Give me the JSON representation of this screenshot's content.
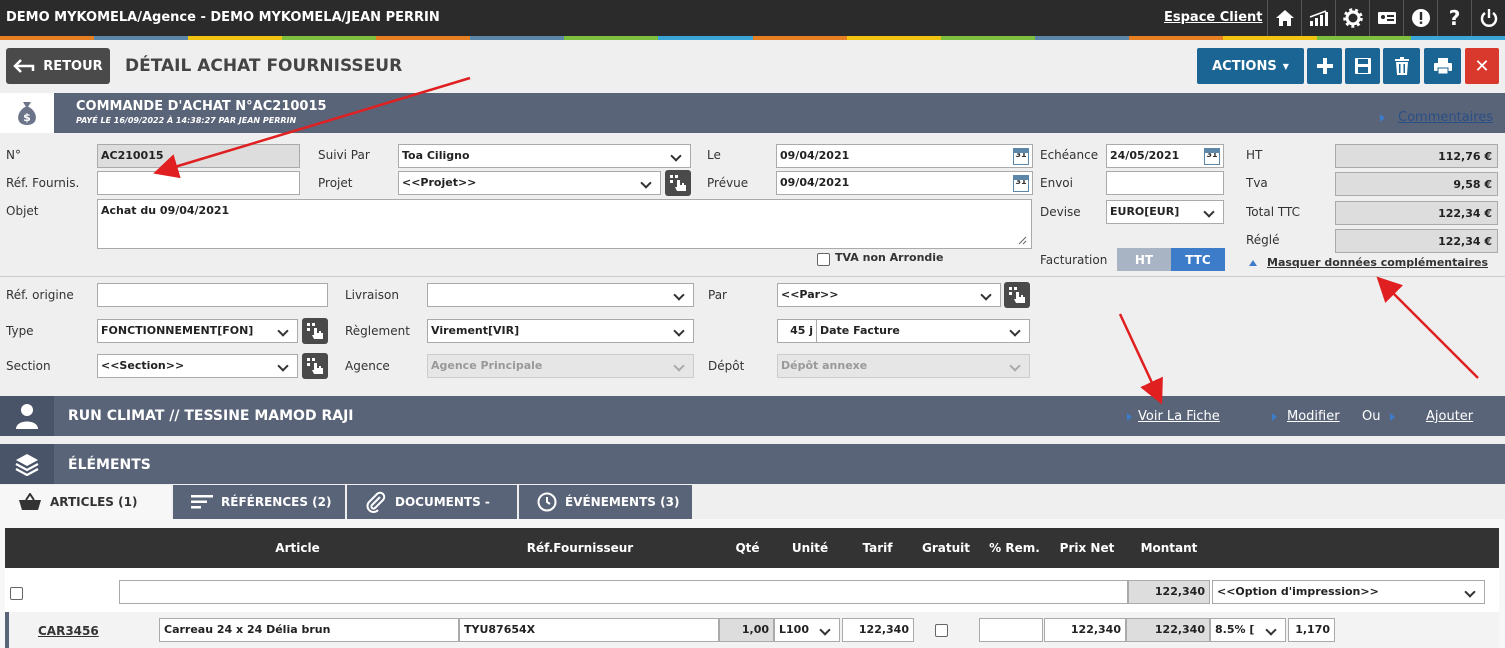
{
  "topbar": {
    "title": "DEMO MYKOMELA/Agence - DEMO MYKOMELA/JEAN PERRIN",
    "espace_client": "Espace Client",
    "icons": [
      "home-icon",
      "chart-icon",
      "gear-icon",
      "card-icon",
      "alert-icon",
      "help-icon",
      "power-icon"
    ]
  },
  "stripe_colors": [
    "#e67e22",
    "#5d87a8",
    "#f1c40f",
    "#7fbf3f",
    "#e67e22",
    "#5d87a8",
    "#7fbf3f",
    "#3aa6d8",
    "#e67e22",
    "#f1c40f",
    "#7fbf3f",
    "#5d87a8",
    "#e67e22",
    "#f1c40f",
    "#7fbf3f",
    "#3aa6d8"
  ],
  "header": {
    "back_label": "RETOUR",
    "page_title": "DÉTAIL ACHAT FOURNISSEUR",
    "actions_label": "ACTIONS"
  },
  "commande": {
    "title": "COMMANDE D'ACHAT N°AC210015",
    "subtitle": "PAYÉ LE 16/09/2022 À 14:38:27 PAR JEAN PERRIN",
    "commentaires": "Commentaires"
  },
  "form": {
    "no_label": "N°",
    "no_value": "AC210015",
    "ref_fournis_label": "Réf. Fournis.",
    "ref_fournis_value": "",
    "objet_label": "Objet",
    "objet_value": "Achat du 09/04/2021",
    "suivi_label": "Suivi Par",
    "suivi_value": "Toa Ciligno",
    "projet_label": "Projet",
    "projet_value": "<<Projet>>",
    "le_label": "Le",
    "le_value": "09/04/2021",
    "prevue_label": "Prévue",
    "prevue_value": "09/04/2021",
    "echeance_label": "Echéance",
    "echeance_value": "24/05/2021",
    "envoi_label": "Envoi",
    "envoi_value": "",
    "devise_label": "Devise",
    "devise_value": "EURO[EUR]",
    "tva_arrondie_label": "TVA non Arrondie",
    "facturation_label": "Facturation",
    "fact_ht": "HT",
    "fact_ttc": "TTC",
    "calendar_day": "31"
  },
  "totals": {
    "ht_label": "HT",
    "ht_value": "112,76 €",
    "tva_label": "Tva",
    "tva_value": "9,58 €",
    "ttc_label": "Total TTC",
    "ttc_value": "122,34 €",
    "regle_label": "Réglé",
    "regle_value": "122,34 €",
    "masquer": "Masquer données complémentaires"
  },
  "form2": {
    "ref_origine_label": "Réf. origine",
    "ref_origine_value": "",
    "livraison_label": "Livraison",
    "livraison_value": "",
    "par_label": "Par",
    "par_value": "<<Par>>",
    "type_label": "Type",
    "type_value": "FONCTIONNEMENT[FON]",
    "reglement_label": "Règlement",
    "reglement_value": "Virement[VIR]",
    "delai_value": "45 j",
    "delai_mode": "Date Facture",
    "section_label": "Section",
    "section_value": "<<Section>>",
    "agence_label": "Agence",
    "agence_value": "Agence Principale",
    "depot_label": "Dépôt",
    "depot_value": "Dépôt annexe"
  },
  "client": {
    "name": "RUN CLIMAT // TESSINE MAMOD RAJI",
    "voir": "Voir La Fiche",
    "modifier": "Modifier",
    "ou": "Ou",
    "ajouter": "Ajouter"
  },
  "elements": {
    "title": "ÉLÉMENTS"
  },
  "tabs": [
    {
      "label": "ARTICLES (1)"
    },
    {
      "label": "RÉFÉRENCES (2)"
    },
    {
      "label": "DOCUMENTS -"
    },
    {
      "label": "ÉVÉNEMENTS (3)"
    }
  ],
  "table": {
    "headers": {
      "article": "Article",
      "ref": "Réf.Fournisseur",
      "qte": "Qté",
      "unite": "Unité",
      "tarif": "Tarif",
      "gratuit": "Gratuit",
      "rem": "% Rem.",
      "prix_net": "Prix Net",
      "montant": "Montant"
    },
    "total_row": {
      "montant": "122,340",
      "option": "<<Option d'impression>>"
    },
    "row": {
      "code": "CAR3456",
      "designation": "Carreau 24 x 24 Délia brun",
      "ref": "TYU87654X",
      "qte": "1,00",
      "unite": "L100",
      "tarif": "122,340",
      "rem": "",
      "prix_net": "122,340",
      "montant": "122,340",
      "tva": "8.5% [",
      "coef": "1,170"
    }
  },
  "colors": {
    "section_bar": "#5a6478",
    "action_blue": "#1a6594",
    "delete_red": "#d9382c",
    "ttc_active": "#3d7cc9",
    "annotation_arrow": "#e02020"
  }
}
